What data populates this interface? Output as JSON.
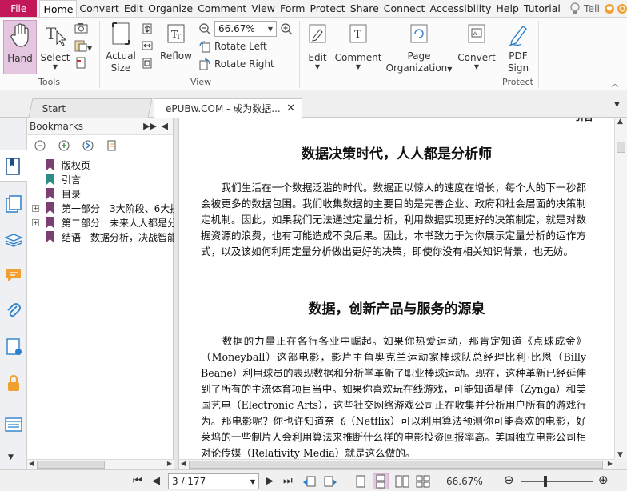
{
  "menubar": {
    "file": "File",
    "items": [
      "Home",
      "Convert",
      "Edit",
      "Organize",
      "Comment",
      "View",
      "Form",
      "Protect",
      "Share",
      "Connect",
      "Accessibility",
      "Help",
      "Tutorial"
    ],
    "tell_me": "Tell"
  },
  "ribbon": {
    "hand": "Hand",
    "select": "Select",
    "actual_size_1": "Actual",
    "actual_size_2": "Size",
    "reflow": "Reflow",
    "zoom_value": "66.67%",
    "rotate_left": "Rotate Left",
    "rotate_right": "Rotate Right",
    "edit": "Edit",
    "comment": "Comment",
    "page_org_1": "Page",
    "page_org_2": "Organization",
    "convert": "Convert",
    "pdf_sign_1": "PDF",
    "pdf_sign_2": "Sign",
    "group_tools": "Tools",
    "group_view": "View",
    "group_protect": "Protect"
  },
  "tabs": {
    "start": "Start",
    "document": "ePUBw.COM - 成为数据..."
  },
  "bookmarks": {
    "title": "Bookmarks",
    "items": [
      {
        "label": "版权页",
        "expandable": false
      },
      {
        "label": "引言",
        "expandable": false
      },
      {
        "label": "目录",
        "expandable": false
      },
      {
        "label": "第一部分　3大阶段、6大技",
        "expandable": true
      },
      {
        "label": "第二部分　未来人人都是分析",
        "expandable": true
      },
      {
        "label": "结语　数据分析，决战智能",
        "expandable": false
      }
    ]
  },
  "document": {
    "corner_fragment": "引言",
    "heading1": "数据决策时代，人人都是分析师",
    "para1": "　　我们生活在一个数据泛滥的时代。数据正以惊人的速度在增长，每个人的下一秒都会被更多的数据包围。我们收集数据的主要目的是完善企业、政府和社会层面的决策制定机制。因此，如果我们无法通过定量分析，利用数据实现更好的决策制定，就是对数据资源的浪费，也有可能造成不良后果。因此，本书致力于为你展示定量分析的运作方式，以及该如何利用定量分析做出更好的决策，即使你没有相关知识背景，也无妨。",
    "heading2": "数据，创新产品与服务的源泉",
    "para2": "　　数据的力量正在各行各业中崛起。如果你热爱运动，那肯定知道《点球成金》（Moneyball）这部电影，影片主角奥克兰运动家棒球队总经理比利·比恩（Billy Beane）利用球员的表现数据和分析学革新了职业棒球运动。现在，这种革新已经延伸到了所有的主流体育项目当中。如果你喜欢玩在线游戏，可能知道星佳（Zynga）和美国艺电（Electronic Arts），这些社交网络游戏公司正在收集并分析用户所有的游戏行为。那电影呢？你也许知道奈飞（Netflix）可以利用算法预测你可能喜欢的电影，好莱坞的一些制片人会利用算法来推断什么样的电影投资回报率高。美国独立电影公司相对论传媒（Relativity Media）就是这么做的。"
  },
  "statusbar": {
    "page": "3 / 177",
    "zoom": "66.67%"
  },
  "colors": {
    "file_button": "#c2185b",
    "hand_active": "#e4c6e0",
    "bookmark_flag": "#7b3f73",
    "bookmark_flag_alt": "#2e8b86"
  }
}
